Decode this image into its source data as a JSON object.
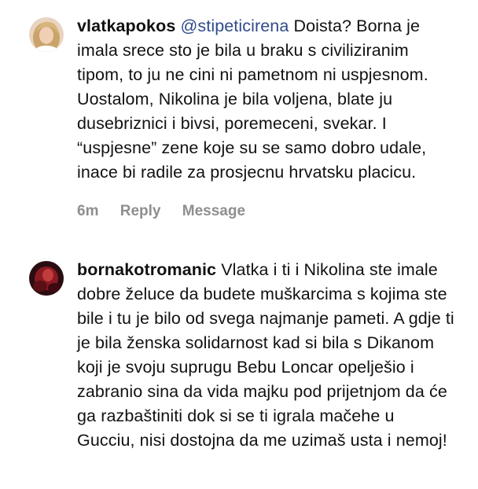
{
  "comments": [
    {
      "username": "vlatkapokos",
      "avatar_icon": "profile-photo-blonde",
      "mention": "@stipeticirena",
      "text": " Doista? Borna je imala srece sto je bila u braku s civiliziranim tipom, to ju ne cini ni pametnom ni uspjesnom. Uostalom, Nikolina je bila voljena, blate ju dusebriznici i bivsi, poremeceni, svekar. I “uspjesne” zene koje su se samo dobro udale, inace bi radile za prosjecnu hrvatsku placicu.",
      "time": "6m",
      "reply_label": "Reply",
      "message_label": "Message"
    },
    {
      "username": "bornakotromanic",
      "avatar_icon": "profile-photo-red",
      "text": " Vlatka i ti i Nikolina ste imale dobre želuce da budete muškarcima s kojima ste bile i tu je bilo od svega najmanje pameti. A gdje ti je bila ženska solidarnost kad si bila s Dikanom koji je svoju suprugu Bebu Loncar opelješio i zabranio sina da vida majku pod prijetnjom da će ga razbaštiniti dok si se ti igrala mačehe u Gucciu, nisi dostojna da me uzimaš usta i nemoj!"
    }
  ],
  "colors": {
    "mention": "#2f4a8a",
    "meta": "#8e8e8e"
  }
}
